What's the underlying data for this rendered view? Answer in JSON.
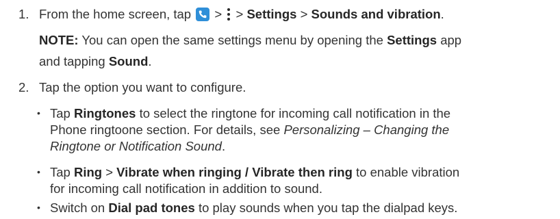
{
  "step1": {
    "number": "1.",
    "prefix": "From the home screen, tap",
    "sep1": ">",
    "sep2": ">",
    "settings": "Settings",
    "sep3": ">",
    "sounds": "Sounds and vibration",
    "end": ".",
    "icons": {
      "phone": "phone-app-icon",
      "menu": "more-options-icon"
    },
    "note": {
      "label": "NOTE:",
      "text1": "You can open the same settings menu by opening the",
      "settings": "Settings",
      "text2": "app",
      "text3": "and tapping",
      "sound": "Sound",
      "end": "."
    }
  },
  "step2": {
    "number": "2.",
    "text": "Tap the option you want to configure.",
    "bullets": [
      {
        "bullet": "•",
        "tap": "Tap",
        "bold": "Ringtones",
        "text1": "to select the ringtone for incoming call notification in the",
        "text2": "Phone ringtoone section. For details, see",
        "italic1": "Personalizing – Changing the",
        "italic2": "Ringtone or Notification Sound",
        "end": "."
      },
      {
        "bullet": "•",
        "tap": "Tap",
        "bold1": "Ring",
        "sep": ">",
        "bold2": "Vibrate when ringing / Vibrate then ring",
        "text1": "to enable vibration",
        "text2": "for incoming call notification in addition to sound."
      },
      {
        "bullet": "•",
        "prefix": "Switch on",
        "bold": "Dial pad tones",
        "text": "to play sounds when you tap the dialpad keys."
      }
    ]
  },
  "colors": {
    "text": "#333333",
    "icon_blue": "#2f8fd8"
  }
}
